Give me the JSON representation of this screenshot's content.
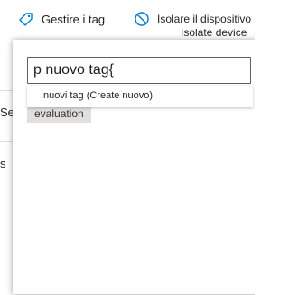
{
  "toolbar": {
    "manage_tags_label": "Gestire i tag",
    "manage_tags_icon": "tag-icon",
    "isolate_label": "Isolare il dispositivo",
    "isolate_icon": "block-icon",
    "isolate_ghost_label": "Isolate device"
  },
  "background": {
    "row1_fragment": "Se",
    "row2_fragment": "s"
  },
  "tag_panel": {
    "input_value": "p nuovo tag{",
    "suggestion_label": "nuovi tag (Create nuovo)",
    "existing_tag": "evaluation"
  },
  "colors": {
    "accent": "#0078d4",
    "border": "#605e5c",
    "chip_bg": "#e1dfdd"
  }
}
